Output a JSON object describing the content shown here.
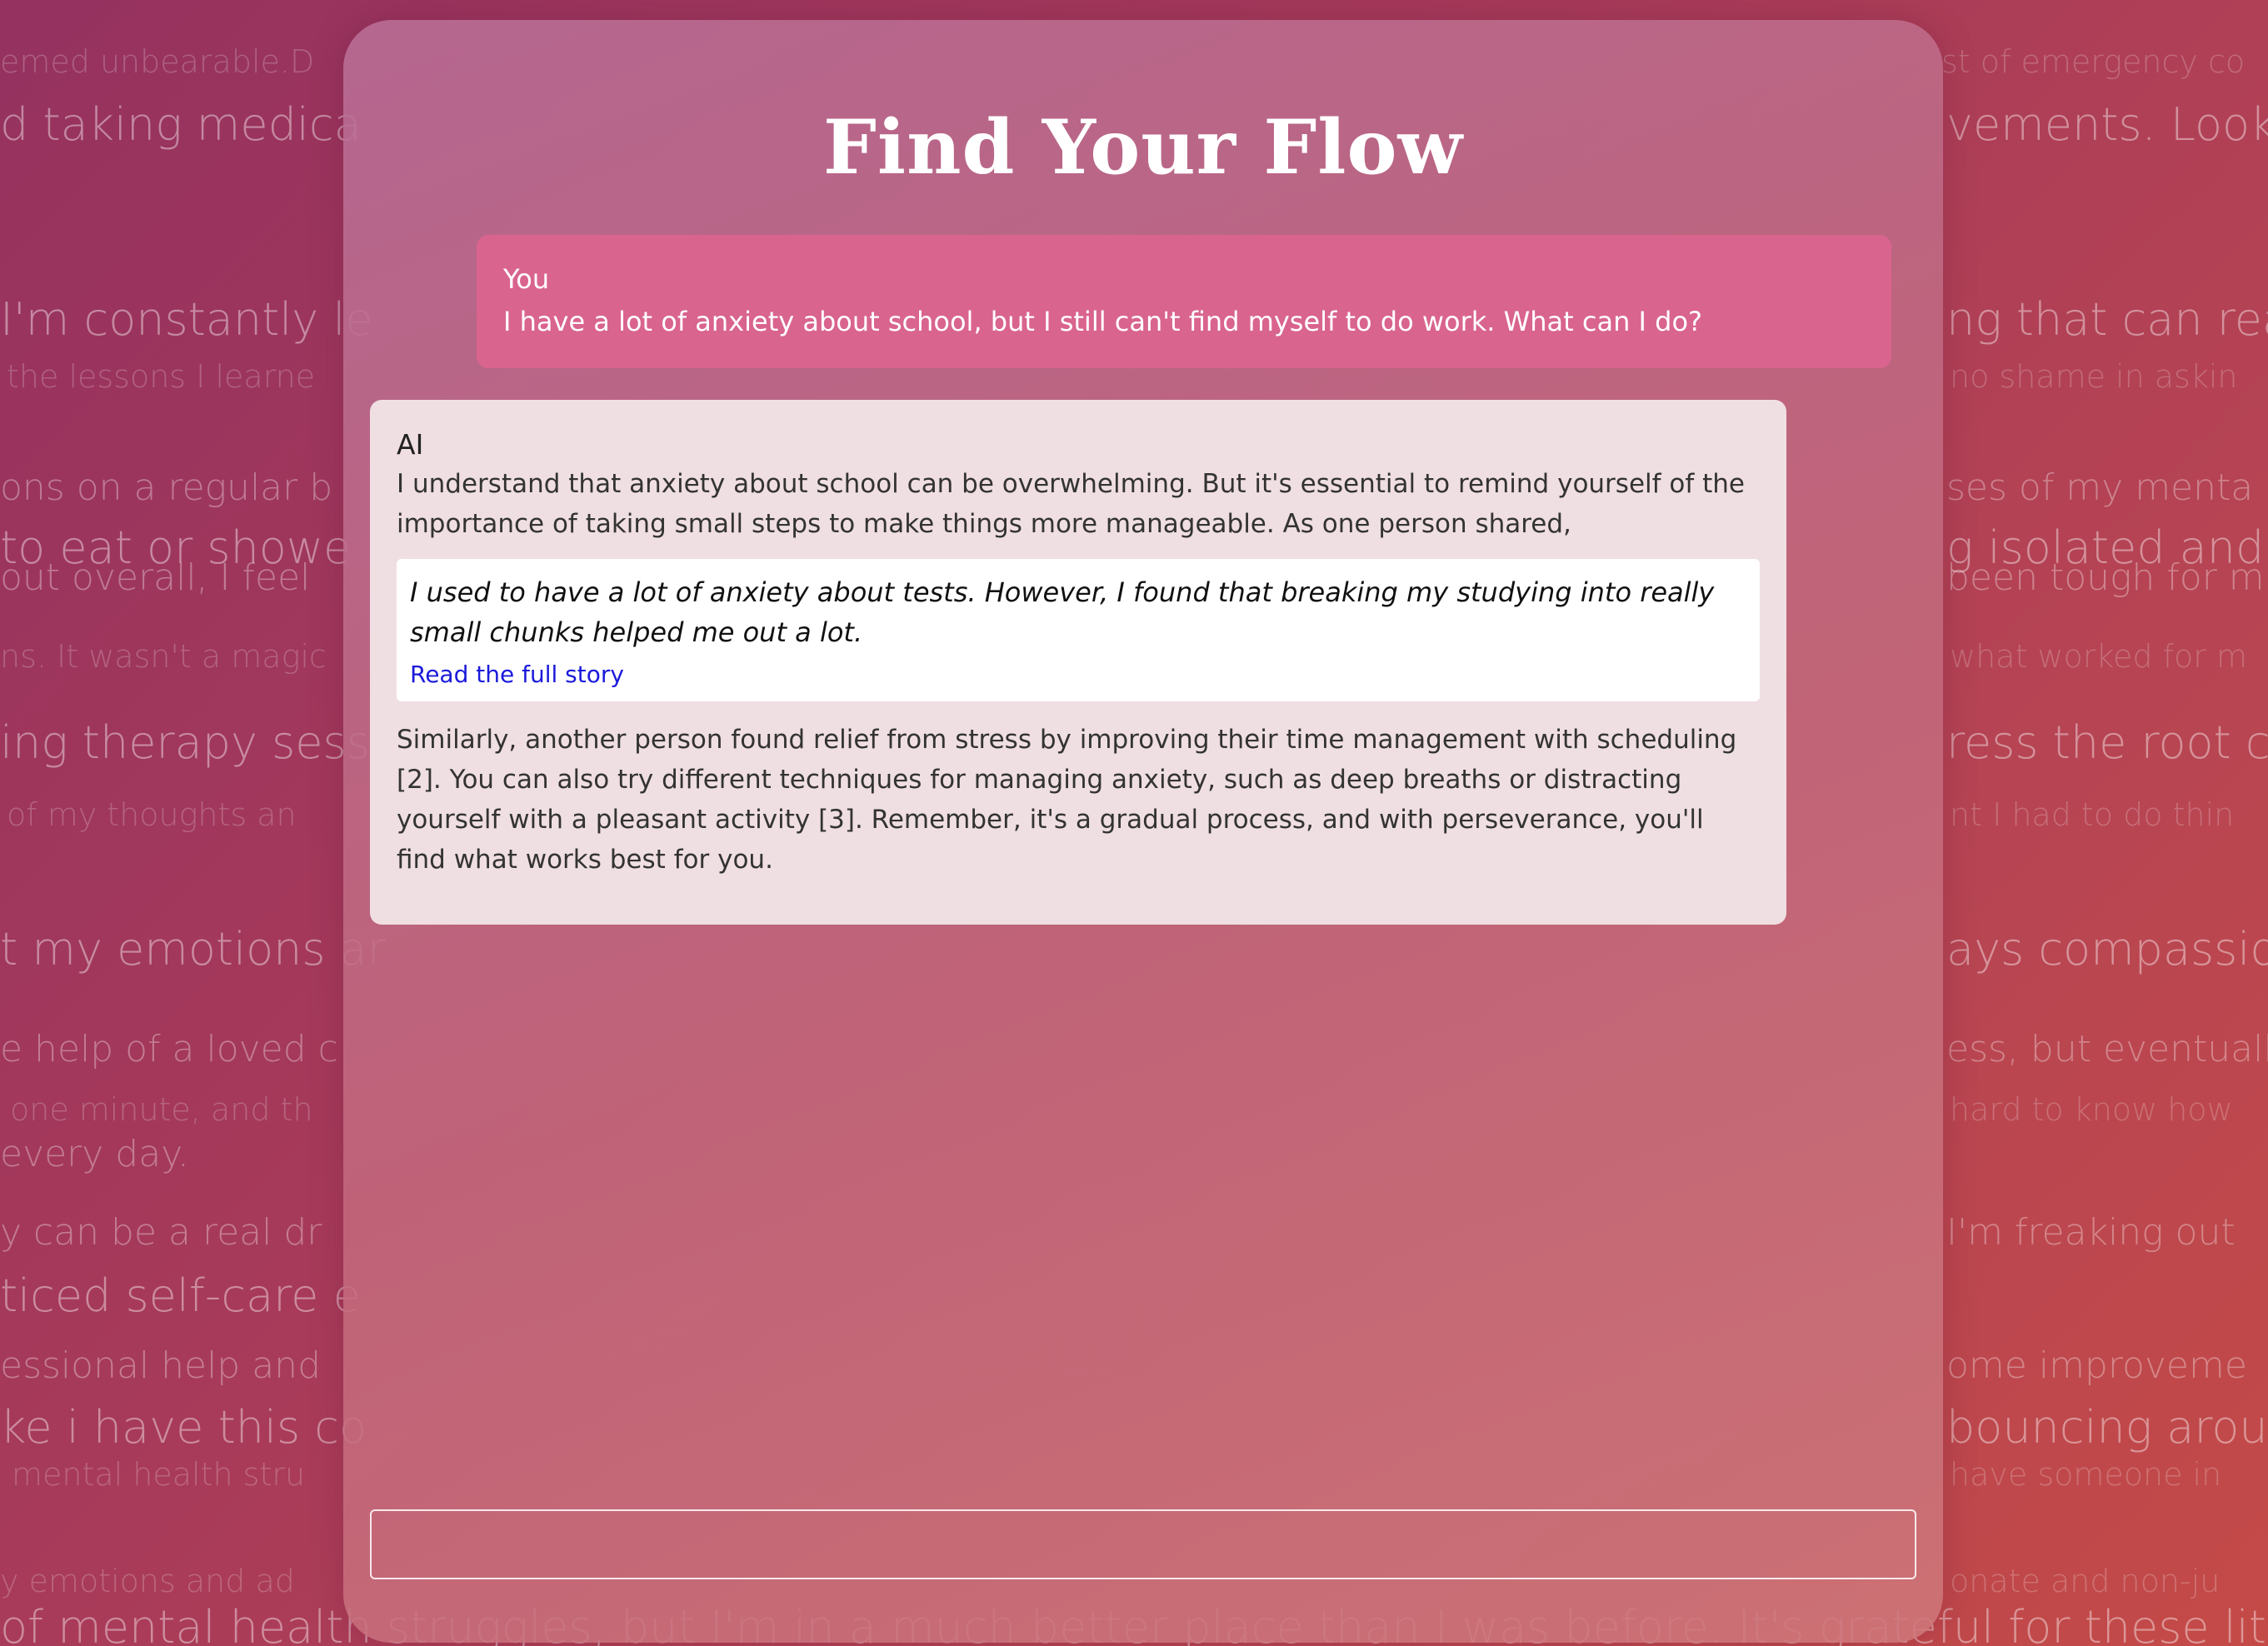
{
  "app": {
    "title": "Find Your Flow"
  },
  "background_text": {
    "left": [
      "emed unbearable.D",
      "d taking medica",
      "I'm constantly le",
      "the lessons I learne",
      "ons on a regular b",
      "to eat or showe",
      "out overall, I feel",
      "ns. It wasn't a magic",
      "ing therapy sessi",
      "of my thoughts an",
      "t my emotions ar",
      "e help of a loved c",
      "one minute, and th",
      "every day.",
      "y can be a real dr",
      "ticed self-care e",
      "essional help and",
      "ke i have this co",
      "mental health stru",
      "y emotions and ad",
      "of mental health struggles, but I'm in a much better place than I was before. It's grateful for these lit"
    ],
    "right": [
      "st of emergency co",
      "vements. Look",
      "ng that can rea",
      "no shame in askin",
      "ses of my menta",
      "g isolated and",
      "been tough for m",
      "what worked for m",
      "ress the root cau",
      "nt I had to do thin",
      "ays compassiona",
      "ess, but eventuall",
      "hard to know how",
      "I'm freaking out",
      "ome improveme",
      "bouncing arour",
      "have someone in",
      "onate and non-ju"
    ]
  },
  "messages": [
    {
      "sender": "You",
      "text": "I have a lot of anxiety about school, but I still can't find myself to do work. What can I do?"
    },
    {
      "sender": "AI",
      "intro": "I understand that anxiety about school can be overwhelming. But it's essential to remind yourself of the importance of taking small steps to make things more manageable. As one person shared,",
      "quote": "I used to have a lot of anxiety about tests. However, I found that breaking my studying into really small chunks helped me out a lot.",
      "quote_link": "Read the full story",
      "outro": "Similarly, another person found relief from stress by improving their time management with scheduling [2]. You can also try different techniques for managing anxiety, such as deep breaths or distracting yourself with a pleasant activity [3]. Remember, it's a gradual process, and with perseverance, you'll find what works best for you."
    }
  ],
  "input": {
    "value": "",
    "placeholder": ""
  },
  "colors": {
    "user_bubble": "#d9648e",
    "ai_bubble": "#f0dfe2",
    "link": "#1a1adb",
    "background_start": "#95325f",
    "background_end": "#c44a47"
  }
}
